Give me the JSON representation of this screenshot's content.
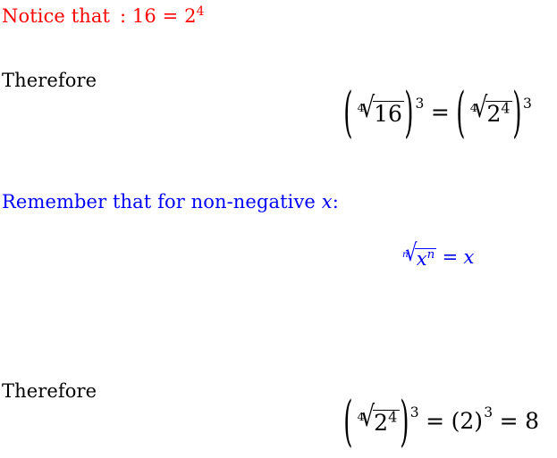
{
  "document": {
    "background_color": "#ffffff",
    "colors": {
      "red": "#ff0000",
      "blue": "#0000ff",
      "black": "#000000"
    }
  },
  "lines": {
    "notice": {
      "prefix": "Notice that",
      "colon": ":",
      "value_left": "16",
      "equals": "=",
      "base": "2",
      "exponent": "4",
      "color": "#ff0000"
    },
    "therefore_1": {
      "label": "Therefore",
      "color": "#000000"
    },
    "remember": {
      "text_before": "Remember that for non-negative",
      "variable": "x",
      "colon": ":",
      "color": "#0000ff"
    },
    "therefore_2": {
      "label": "Therefore",
      "color": "#000000"
    }
  },
  "equations": {
    "eq1": {
      "color": "#000000",
      "left": {
        "open_paren": "(",
        "radical_index": "4",
        "surd": "√",
        "radicand": "16",
        "close_paren": ")",
        "power": "3"
      },
      "relation": "=",
      "right": {
        "open_paren": "(",
        "radical_index": "4",
        "surd": "√",
        "radicand_base": "2",
        "radicand_exponent": "4",
        "close_paren": ")",
        "power": "3"
      }
    },
    "eq2": {
      "color": "#0000ff",
      "radical_index": "n",
      "surd": "√",
      "radicand_base": "x",
      "radicand_exponent": "n",
      "relation": "=",
      "result": "x"
    },
    "eq3": {
      "color": "#000000",
      "left": {
        "open_paren": "(",
        "radical_index": "4",
        "surd": "√",
        "radicand_base": "2",
        "radicand_exponent": "4",
        "close_paren": ")",
        "power": "3"
      },
      "relation_1": "=",
      "middle": {
        "open_paren": "(",
        "value": "2",
        "close_paren": ")",
        "power": "3"
      },
      "relation_2": "=",
      "result": "8"
    }
  }
}
